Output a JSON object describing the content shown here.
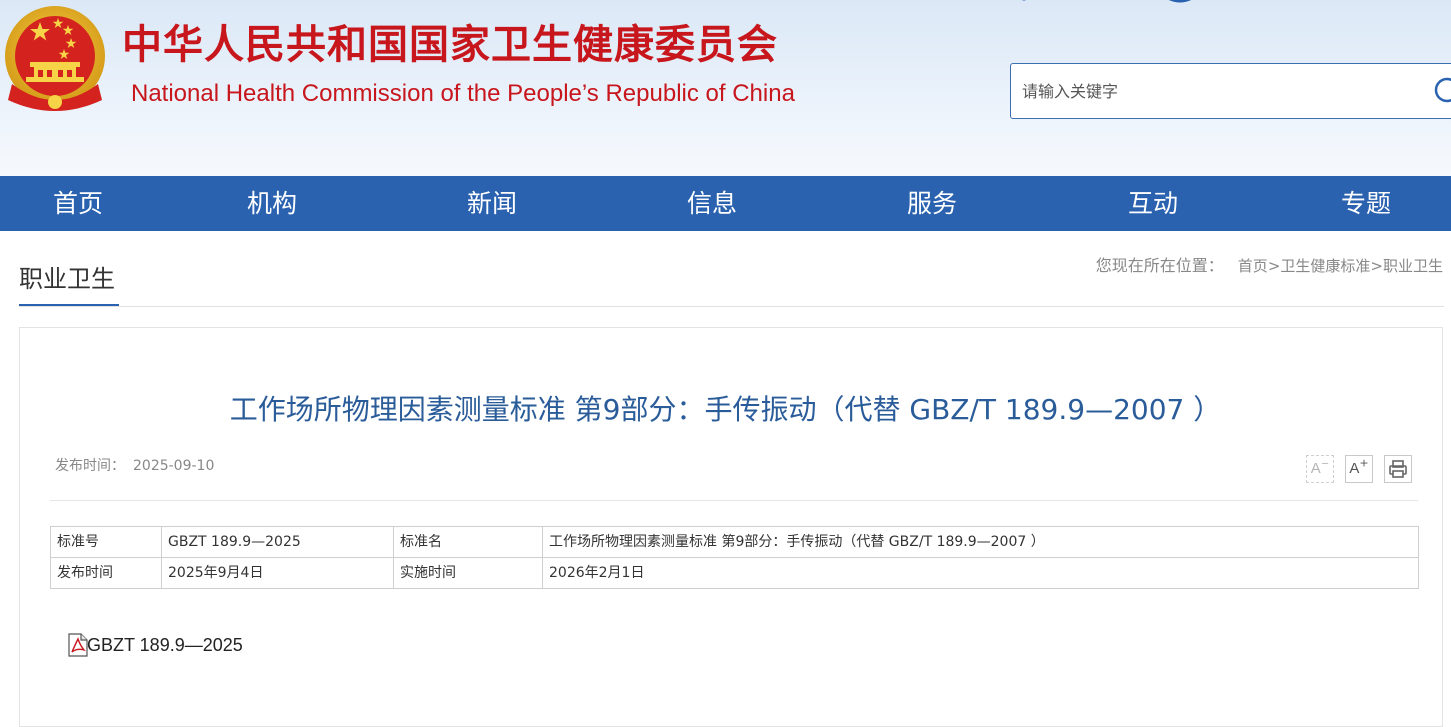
{
  "header": {
    "title_cn": "中华人民共和国国家卫生健康委员会",
    "title_en": "National Health Commission of the People’s  Republic of China",
    "search": {
      "placeholder": "请输入关键字",
      "value": "",
      "icon": "search-icon"
    }
  },
  "nav": {
    "items": [
      {
        "label": "首页"
      },
      {
        "label": "机构"
      },
      {
        "label": "新闻"
      },
      {
        "label": "信息"
      },
      {
        "label": "服务"
      },
      {
        "label": "互动"
      },
      {
        "label": "专题"
      }
    ]
  },
  "section": {
    "title": "职业卫生"
  },
  "breadcrumb": {
    "label": "您现在所在位置：",
    "items": [
      "首页",
      "卫生健康标准",
      "职业卫生"
    ],
    "separator": ">"
  },
  "article": {
    "title": "工作场所物理因素测量标准 第9部分：手传振动（代替 GBZ/T 189.9—2007 ）",
    "publish_label": "发布时间：",
    "publish_date": "2025-09-10",
    "tools": {
      "font_smaller": "A",
      "font_larger": "A",
      "print_icon": "printer-icon"
    },
    "info_table": {
      "rows": [
        [
          "标准号",
          "GBZT 189.9—2025",
          "标准名",
          "工作场所物理因素测量标准 第9部分：手传振动（代替 GBZ/T 189.9—2007 ）"
        ],
        [
          "发布时间",
          "2025年9月4日",
          "实施时间",
          "2026年2月1日"
        ]
      ]
    },
    "attachment": {
      "icon": "pdf-file-icon",
      "label": "GBZT 189.9—2025"
    }
  },
  "colors": {
    "brand_red": "#c8161d",
    "nav_blue": "#2a62b0",
    "title_blue": "#2a5c9a"
  }
}
